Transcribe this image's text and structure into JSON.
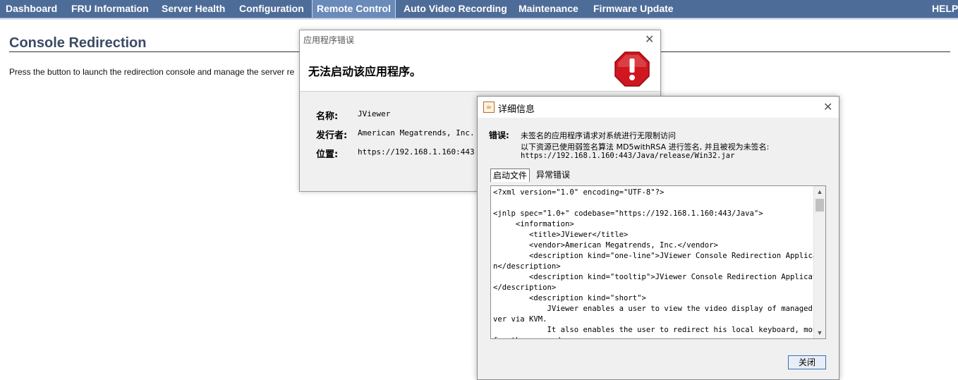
{
  "nav": {
    "items": [
      "Dashboard",
      "FRU Information",
      "Server Health",
      "Configuration",
      "Remote Control",
      "Auto Video Recording",
      "Maintenance",
      "Firmware Update"
    ],
    "active": "Remote Control",
    "help": "HELP"
  },
  "page": {
    "title": "Console Redirection",
    "description": "Press the button to launch the redirection console and manage the server re"
  },
  "error_dialog": {
    "title": "应用程序错误",
    "message": "无法启动该应用程序。",
    "fields": [
      {
        "label": "名称:",
        "value": "JViewer"
      },
      {
        "label": "发行者:",
        "value": "American Megatrends, Inc."
      },
      {
        "label": "位置:",
        "value": "https://192.168.1.160:443"
      }
    ]
  },
  "details_dialog": {
    "title": "详细信息",
    "error_label": "错误:",
    "error_lines": [
      "未签名的应用程序请求对系统进行无限制访问",
      "以下资源已使用弱签名算法 MD5withRSA 进行签名, 并且被视为未签名:",
      "https://192.168.1.160:443/Java/release/Win32.jar"
    ],
    "tabs": [
      "启动文件",
      "异常错误"
    ],
    "active_tab": "启动文件",
    "code_lines": [
      "<?xml version=\"1.0\" encoding=\"UTF-8\"?>",
      "",
      "<jnlp spec=\"1.0+\" codebase=\"https://192.168.1.160:443/Java\">",
      "     <information>",
      "        <title>JViewer</title>",
      "        <vendor>American Megatrends, Inc.</vendor>",
      "        <description kind=\"one-line\">JViewer Console Redirection Applicatio",
      "n</description>",
      "        <description kind=\"tooltip\">JViewer Console Redirection Application",
      "</description>",
      "        <description kind=\"short\">",
      "            JViewer enables a user to view the video display of managed ser",
      "ver via KVM.",
      "            It also enables the user to redirect his local keyboard, mouse",
      "for the managed server."
    ],
    "close_label": "关闭"
  },
  "colors": {
    "nav_bg": "#4e6c98",
    "title_color": "#3b4a64",
    "stop_red": "#d0161e"
  }
}
